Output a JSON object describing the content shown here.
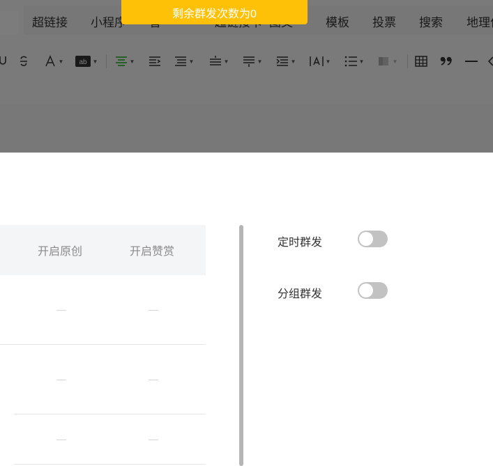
{
  "toast": {
    "text": "剩余群发次数为0"
  },
  "menubar": {
    "items": [
      "超链接",
      "小程序",
      "音",
      "超链接卡",
      "图文",
      "模板",
      "投票",
      "搜索",
      "地理位置"
    ]
  },
  "toolbar": {
    "items": [
      {
        "icon": "underline-icon",
        "glyph": "U"
      },
      {
        "icon": "strikethrough-icon",
        "glyph": "S"
      },
      {
        "icon": "font-color-icon",
        "glyph": "A"
      },
      {
        "icon": "background-color-icon",
        "glyph": "ab"
      },
      {
        "icon": "align-center-icon"
      },
      {
        "icon": "indent-icon"
      },
      {
        "icon": "align-justify-icon"
      },
      {
        "icon": "line-height-icon"
      },
      {
        "icon": "paragraph-spacing-icon"
      },
      {
        "icon": "first-line-indent-icon"
      },
      {
        "icon": "letter-spacing-icon"
      },
      {
        "icon": "list-icon"
      },
      {
        "icon": "format-painter-icon"
      },
      {
        "icon": "table-icon"
      },
      {
        "icon": "quote-icon"
      },
      {
        "icon": "horizontal-rule-icon"
      }
    ],
    "active_color": "#1aad19"
  },
  "table": {
    "headers": [
      "开启原创",
      "开启赞赏"
    ],
    "rows": [
      {
        "original": "—",
        "reward": "—"
      },
      {
        "original": "—",
        "reward": "—"
      },
      {
        "original": "—",
        "reward": "—"
      }
    ]
  },
  "settings": {
    "scheduled": {
      "label": "定时群发",
      "enabled": false
    },
    "group": {
      "label": "分组群发",
      "enabled": false
    }
  },
  "colors": {
    "toast_bg": "#ffc107",
    "toggle_off": "#c2c2c2"
  }
}
